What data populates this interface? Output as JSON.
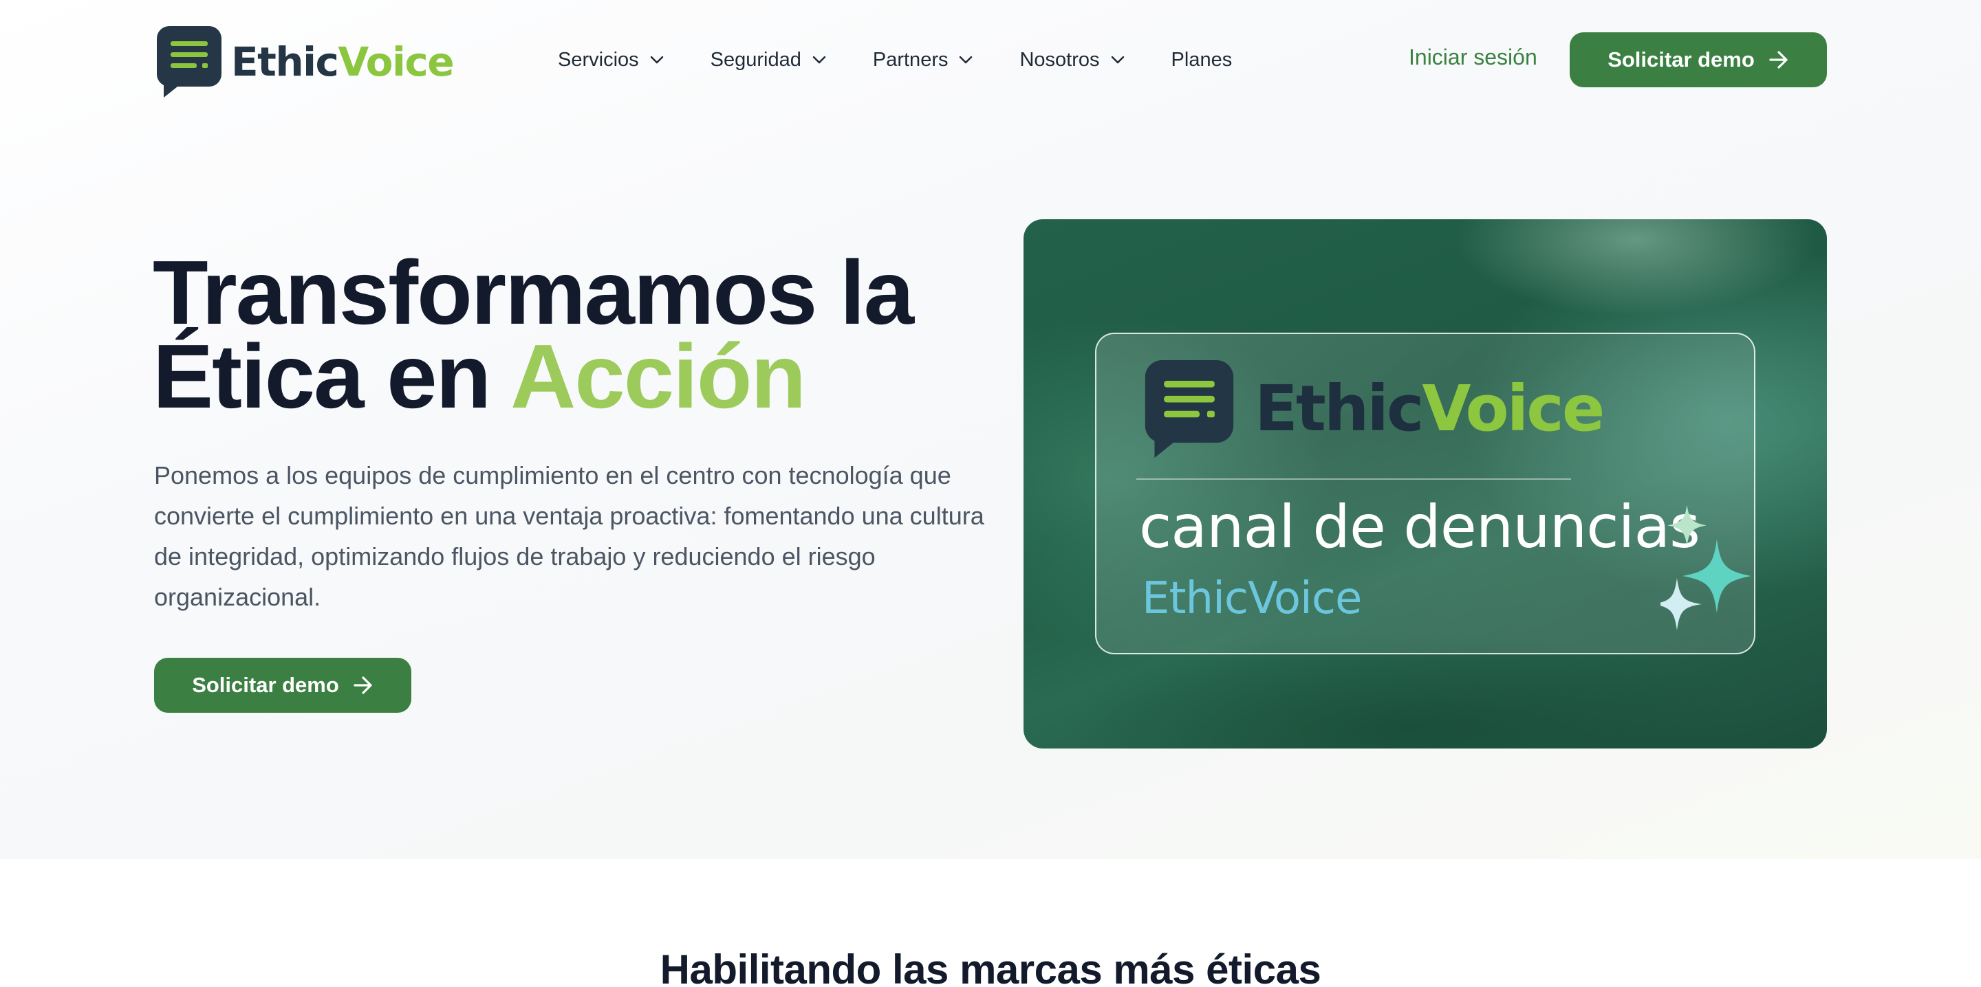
{
  "brand": {
    "name_part1": "Ethic",
    "name_part2": "Voice",
    "colors": {
      "dark": "#243545",
      "green": "#8cc63f",
      "button": "#3b7f42"
    }
  },
  "nav": {
    "items": [
      {
        "label": "Servicios",
        "has_dropdown": true
      },
      {
        "label": "Seguridad",
        "has_dropdown": true
      },
      {
        "label": "Partners",
        "has_dropdown": true
      },
      {
        "label": "Nosotros",
        "has_dropdown": true
      },
      {
        "label": "Planes",
        "has_dropdown": false
      }
    ],
    "login_label": "Iniciar sesión",
    "demo_label": "Solicitar demo"
  },
  "hero": {
    "headline_line1": "Transformamos la",
    "headline_line2_start": "Ética en ",
    "headline_accent": "Acción",
    "lead": "Ponemos a los equipos de cumplimiento en el centro con tecnología que convierte el cumplimiento en una ventaja proactiva: fomentando una cultura de integridad, optimizando flujos de trabajo y reduciendo el riesgo organizacional.",
    "cta_label": "Solicitar demo"
  },
  "feature_card": {
    "logo_part1": "Ethic",
    "logo_part2": "Voice",
    "title": "canal de denuncias",
    "subtitle": "EthicVoice"
  },
  "brands_section": {
    "title": "Habilitando las marcas más éticas"
  }
}
